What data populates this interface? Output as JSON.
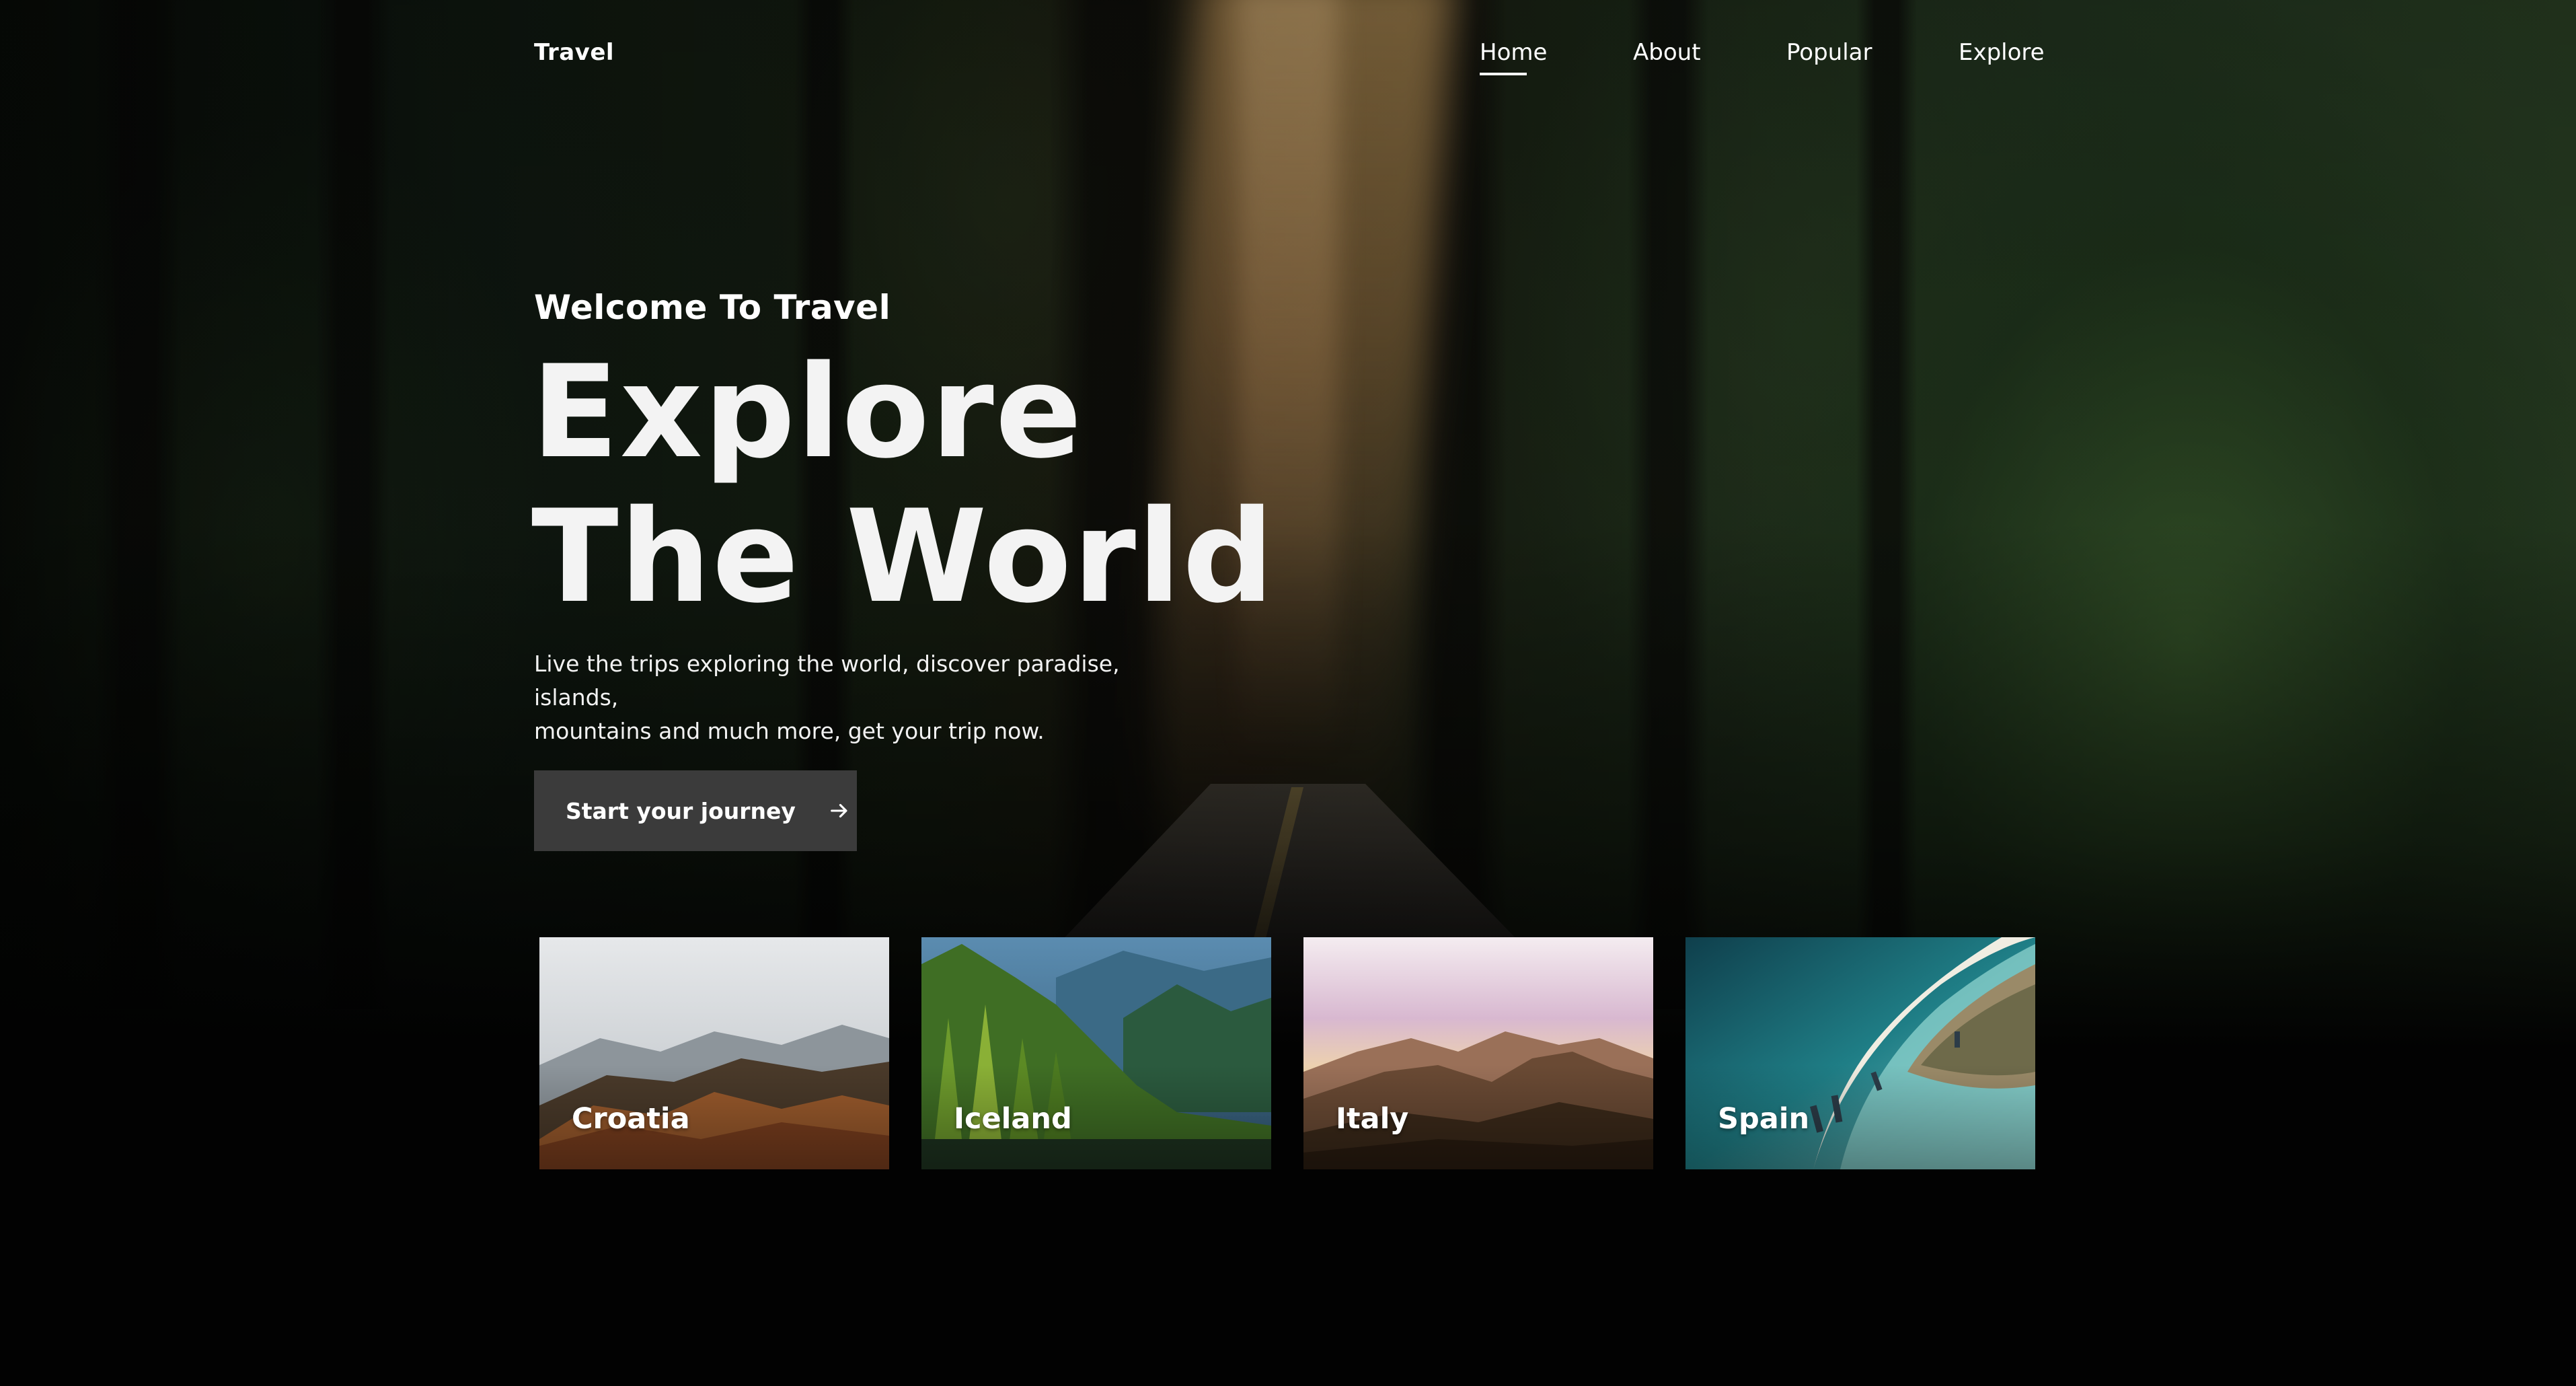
{
  "header": {
    "brand": "Travel",
    "nav": [
      {
        "label": "Home",
        "active": true
      },
      {
        "label": "About",
        "active": false
      },
      {
        "label": "Popular",
        "active": false
      },
      {
        "label": "Explore",
        "active": false
      }
    ]
  },
  "hero": {
    "welcome": "Welcome To Travel",
    "headline_line1": "Explore",
    "headline_line2": "The World",
    "description_line1": "Live the trips exploring the world, discover paradise, islands,",
    "description_line2": "mountains and much more, get your trip now.",
    "cta_label": "Start your journey",
    "cta_icon": "arrow-right-icon"
  },
  "destinations": [
    {
      "name": "Croatia"
    },
    {
      "name": "Iceland"
    },
    {
      "name": "Italy"
    },
    {
      "name": "Spain"
    }
  ],
  "colors": {
    "page_background": "#020202",
    "text": "#ffffff",
    "cta_background": "#3b3b3b"
  }
}
